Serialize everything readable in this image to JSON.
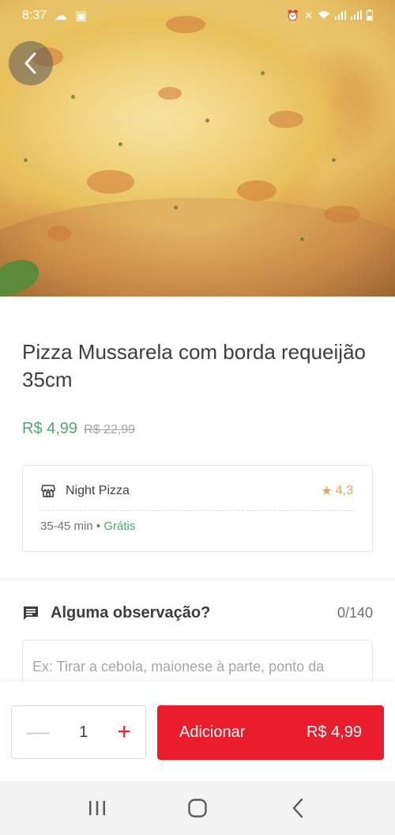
{
  "status_bar": {
    "time": "8:37"
  },
  "hero": {
    "back_icon": "chevron-left-icon"
  },
  "product": {
    "title": "Pizza Mussarela com borda requeijão 35cm",
    "price_current": "R$ 4,99",
    "price_old": "R$ 22,99"
  },
  "store": {
    "name": "Night Pizza",
    "rating": "4,3",
    "delivery_time": "35-45 min",
    "separator": "•",
    "delivery_fee": "Grátis"
  },
  "observation": {
    "label": "Alguma observação?",
    "counter": "0/140",
    "placeholder": "Ex: Tirar a cebola, maionese à parte, ponto da carne, etc."
  },
  "cart": {
    "quantity": "1",
    "add_label": "Adicionar",
    "add_price": "R$ 4,99"
  },
  "colors": {
    "brand_red": "#ea1d2c",
    "price_green": "#50a773",
    "rating_gold": "#e7a74e"
  }
}
